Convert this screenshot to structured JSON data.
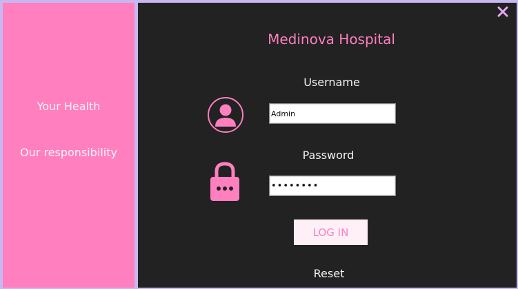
{
  "sidebar": {
    "tagline_1": "Your Health",
    "tagline_2": "Our responsibility"
  },
  "header": {
    "title": "Medinova Hospital"
  },
  "form": {
    "username_label": "Username",
    "username_value": "Admin",
    "password_label": "Password",
    "password_value": "password",
    "login_label": "LOG IN",
    "reset_label": "Reset"
  },
  "icons": {
    "close": "close-icon",
    "user": "user-icon",
    "lock": "lock-icon"
  },
  "colors": {
    "accent_pink": "#ff7fbf",
    "main_background": "#222222",
    "border_lavender": "#c9b8f0",
    "button_background": "#fff0f8"
  }
}
